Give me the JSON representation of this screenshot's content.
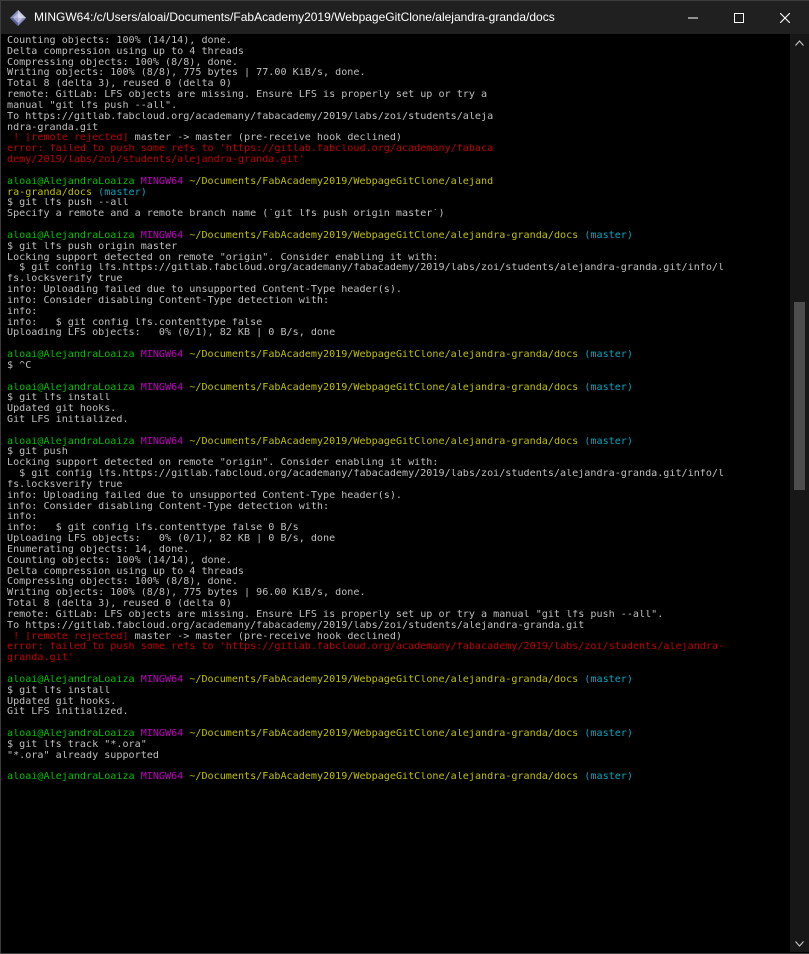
{
  "window": {
    "title": "MINGW64:/c/Users/aloai/Documents/FabAcademy2019/WebpageGitClone/alejandra-granda/docs",
    "icon": "git-bash-diamond-icon",
    "controls": [
      "minimize-icon",
      "maximize-icon",
      "close-icon"
    ]
  },
  "colors": {
    "background": "#000000",
    "text": "#bfbfbf",
    "error_red": "#bf0000",
    "prompt_green": "#00bf00",
    "prompt_magenta": "#bf00bf",
    "path_yellow": "#bfbf00",
    "branch_cyan": "#00a6bf"
  },
  "terminal": {
    "lines": [
      [
        [
          "w",
          "Counting objects: 100% (14/14), done."
        ]
      ],
      [
        [
          "w",
          "Delta compression using up to 4 threads"
        ]
      ],
      [
        [
          "w",
          "Compressing objects: 100% (8/8), done."
        ]
      ],
      [
        [
          "w",
          "Writing objects: 100% (8/8), 775 bytes | 77.00 KiB/s, done."
        ]
      ],
      [
        [
          "w",
          "Total 8 (delta 3), reused 0 (delta 0)"
        ]
      ],
      [
        [
          "w",
          "remote: GitLab: LFS objects are missing. Ensure LFS is properly set up or try a"
        ]
      ],
      [
        [
          "w",
          "manual \"git lfs push --all\"."
        ]
      ],
      [
        [
          "w",
          "To https://gitlab.fabcloud.org/academany/fabacademy/2019/labs/zoi/students/aleja"
        ]
      ],
      [
        [
          "w",
          "ndra-granda.git"
        ]
      ],
      [
        [
          "r",
          " ! [remote rejected] "
        ],
        [
          "w",
          "master -> master (pre-receive hook declined)"
        ]
      ],
      [
        [
          "r",
          "error: failed to push some refs to 'https://gitlab.fabcloud.org/academany/fabaca"
        ]
      ],
      [
        [
          "r",
          "demy/2019/labs/zoi/students/alejandra-granda.git'"
        ]
      ],
      [
        [
          "w",
          ""
        ]
      ],
      [
        [
          "g",
          "aloai@AlejandraLoaiza "
        ],
        [
          "m",
          "MINGW64 "
        ],
        [
          "y",
          "~/Documents/FabAcademy2019/WebpageGitClone/alejand"
        ]
      ],
      [
        [
          "y",
          "ra-granda/docs"
        ],
        [
          "c",
          " (master)"
        ]
      ],
      [
        [
          "w",
          "$ git lfs push --all"
        ]
      ],
      [
        [
          "w",
          "Specify a remote and a remote branch name (`git lfs push origin master`)"
        ]
      ],
      [
        [
          "w",
          ""
        ]
      ],
      [
        [
          "g",
          "aloai@AlejandraLoaiza "
        ],
        [
          "m",
          "MINGW64 "
        ],
        [
          "y",
          "~/Documents/FabAcademy2019/WebpageGitClone/alejandra-granda/docs"
        ],
        [
          "c",
          " (master)"
        ]
      ],
      [
        [
          "w",
          "$ git lfs push origin master"
        ]
      ],
      [
        [
          "w",
          "Locking support detected on remote \"origin\". Consider enabling it with:"
        ]
      ],
      [
        [
          "w",
          "  $ git config lfs.https://gitlab.fabcloud.org/academany/fabacademy/2019/labs/zoi/students/alejandra-granda.git/info/l"
        ]
      ],
      [
        [
          "w",
          "fs.locksverify true"
        ]
      ],
      [
        [
          "w",
          "info: Uploading failed due to unsupported Content-Type header(s)."
        ]
      ],
      [
        [
          "w",
          "info: Consider disabling Content-Type detection with:"
        ]
      ],
      [
        [
          "w",
          "info:"
        ]
      ],
      [
        [
          "w",
          "info:   $ git config lfs.contenttype false"
        ]
      ],
      [
        [
          "w",
          "Uploading LFS objects:   0% (0/1), 82 KB | 0 B/s, done"
        ]
      ],
      [
        [
          "w",
          ""
        ]
      ],
      [
        [
          "g",
          "aloai@AlejandraLoaiza "
        ],
        [
          "m",
          "MINGW64 "
        ],
        [
          "y",
          "~/Documents/FabAcademy2019/WebpageGitClone/alejandra-granda/docs"
        ],
        [
          "c",
          " (master)"
        ]
      ],
      [
        [
          "w",
          "$ ^C"
        ]
      ],
      [
        [
          "w",
          ""
        ]
      ],
      [
        [
          "g",
          "aloai@AlejandraLoaiza "
        ],
        [
          "m",
          "MINGW64 "
        ],
        [
          "y",
          "~/Documents/FabAcademy2019/WebpageGitClone/alejandra-granda/docs"
        ],
        [
          "c",
          " (master)"
        ]
      ],
      [
        [
          "w",
          "$ git lfs install"
        ]
      ],
      [
        [
          "w",
          "Updated git hooks."
        ]
      ],
      [
        [
          "w",
          "Git LFS initialized."
        ]
      ],
      [
        [
          "w",
          ""
        ]
      ],
      [
        [
          "g",
          "aloai@AlejandraLoaiza "
        ],
        [
          "m",
          "MINGW64 "
        ],
        [
          "y",
          "~/Documents/FabAcademy2019/WebpageGitClone/alejandra-granda/docs"
        ],
        [
          "c",
          " (master)"
        ]
      ],
      [
        [
          "w",
          "$ git push"
        ]
      ],
      [
        [
          "w",
          "Locking support detected on remote \"origin\". Consider enabling it with:"
        ]
      ],
      [
        [
          "w",
          "  $ git config lfs.https://gitlab.fabcloud.org/academany/fabacademy/2019/labs/zoi/students/alejandra-granda.git/info/l"
        ]
      ],
      [
        [
          "w",
          "fs.locksverify true"
        ]
      ],
      [
        [
          "w",
          "info: Uploading failed due to unsupported Content-Type header(s)."
        ]
      ],
      [
        [
          "w",
          "info: Consider disabling Content-Type detection with:"
        ]
      ],
      [
        [
          "w",
          "info:"
        ]
      ],
      [
        [
          "w",
          "info:   $ git config lfs.contenttype false 0 B/s"
        ]
      ],
      [
        [
          "w",
          "Uploading LFS objects:   0% (0/1), 82 KB | 0 B/s, done"
        ]
      ],
      [
        [
          "w",
          "Enumerating objects: 14, done."
        ]
      ],
      [
        [
          "w",
          "Counting objects: 100% (14/14), done."
        ]
      ],
      [
        [
          "w",
          "Delta compression using up to 4 threads"
        ]
      ],
      [
        [
          "w",
          "Compressing objects: 100% (8/8), done."
        ]
      ],
      [
        [
          "w",
          "Writing objects: 100% (8/8), 775 bytes | 96.00 KiB/s, done."
        ]
      ],
      [
        [
          "w",
          "Total 8 (delta 3), reused 0 (delta 0)"
        ]
      ],
      [
        [
          "w",
          "remote: GitLab: LFS objects are missing. Ensure LFS is properly set up or try a manual \"git lfs push --all\"."
        ]
      ],
      [
        [
          "w",
          "To https://gitlab.fabcloud.org/academany/fabacademy/2019/labs/zoi/students/alejandra-granda.git"
        ]
      ],
      [
        [
          "r",
          " ! [remote rejected] "
        ],
        [
          "w",
          "master -> master (pre-receive hook declined)"
        ]
      ],
      [
        [
          "r",
          "error: failed to push some refs to 'https://gitlab.fabcloud.org/academany/fabacademy/2019/labs/zoi/students/alejandra-"
        ]
      ],
      [
        [
          "r",
          "granda.git'"
        ]
      ],
      [
        [
          "w",
          ""
        ]
      ],
      [
        [
          "g",
          "aloai@AlejandraLoaiza "
        ],
        [
          "m",
          "MINGW64 "
        ],
        [
          "y",
          "~/Documents/FabAcademy2019/WebpageGitClone/alejandra-granda/docs"
        ],
        [
          "c",
          " (master)"
        ]
      ],
      [
        [
          "w",
          "$ git lfs install"
        ]
      ],
      [
        [
          "w",
          "Updated git hooks."
        ]
      ],
      [
        [
          "w",
          "Git LFS initialized."
        ]
      ],
      [
        [
          "w",
          ""
        ]
      ],
      [
        [
          "g",
          "aloai@AlejandraLoaiza "
        ],
        [
          "m",
          "MINGW64 "
        ],
        [
          "y",
          "~/Documents/FabAcademy2019/WebpageGitClone/alejandra-granda/docs"
        ],
        [
          "c",
          " (master)"
        ]
      ],
      [
        [
          "w",
          "$ git lfs track \"*.ora\""
        ]
      ],
      [
        [
          "w",
          "\"*.ora\" already supported"
        ]
      ],
      [
        [
          "w",
          ""
        ]
      ],
      [
        [
          "g",
          "aloai@AlejandraLoaiza "
        ],
        [
          "m",
          "MINGW64 "
        ],
        [
          "y",
          "~/Documents/FabAcademy2019/WebpageGitClone/alejandra-granda/docs"
        ],
        [
          "c",
          " (master)"
        ]
      ]
    ]
  },
  "scrollbar": {
    "position_fraction": 0.36,
    "up_icon": "chevron-up-icon",
    "down_icon": "chevron-down-icon"
  }
}
